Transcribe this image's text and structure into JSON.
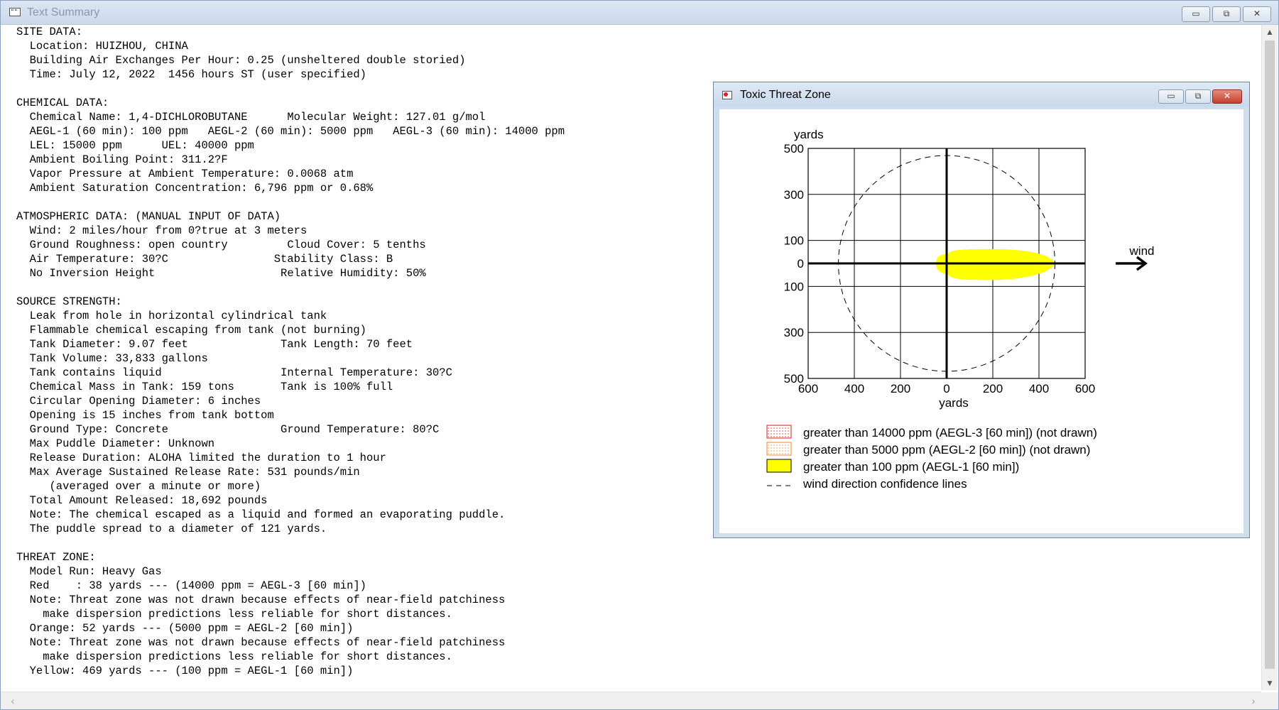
{
  "main_window": {
    "title": "Text Summary",
    "icon_text": "\"\"",
    "controls": {
      "minimize": "▭",
      "maximize": "⧉",
      "close": "✕"
    }
  },
  "summary_text": [
    "SITE DATA:",
    "  Location: HUIZHOU, CHINA",
    "  Building Air Exchanges Per Hour: 0.25 (unsheltered double storied)",
    "  Time: July 12, 2022  1456 hours ST (user specified)",
    "",
    "CHEMICAL DATA:",
    "  Chemical Name: 1,4-DICHLOROBUTANE      Molecular Weight: 127.01 g/mol",
    "  AEGL-1 (60 min): 100 ppm   AEGL-2 (60 min): 5000 ppm   AEGL-3 (60 min): 14000 ppm",
    "  LEL: 15000 ppm      UEL: 40000 ppm",
    "  Ambient Boiling Point: 311.2?F",
    "  Vapor Pressure at Ambient Temperature: 0.0068 atm",
    "  Ambient Saturation Concentration: 6,796 ppm or 0.68%",
    "",
    "ATMOSPHERIC DATA: (MANUAL INPUT OF DATA)",
    "  Wind: 2 miles/hour from 0?true at 3 meters",
    "  Ground Roughness: open country         Cloud Cover: 5 tenths",
    "  Air Temperature: 30?C                Stability Class: B",
    "  No Inversion Height                   Relative Humidity: 50%",
    "",
    "SOURCE STRENGTH:",
    "  Leak from hole in horizontal cylindrical tank",
    "  Flammable chemical escaping from tank (not burning)",
    "  Tank Diameter: 9.07 feet              Tank Length: 70 feet",
    "  Tank Volume: 33,833 gallons",
    "  Tank contains liquid                  Internal Temperature: 30?C",
    "  Chemical Mass in Tank: 159 tons       Tank is 100% full",
    "  Circular Opening Diameter: 6 inches",
    "  Opening is 15 inches from tank bottom",
    "  Ground Type: Concrete                 Ground Temperature: 80?C",
    "  Max Puddle Diameter: Unknown",
    "  Release Duration: ALOHA limited the duration to 1 hour",
    "  Max Average Sustained Release Rate: 531 pounds/min",
    "     (averaged over a minute or more)",
    "  Total Amount Released: 18,692 pounds",
    "  Note: The chemical escaped as a liquid and formed an evaporating puddle.",
    "  The puddle spread to a diameter of 121 yards.",
    "",
    "THREAT ZONE:",
    "  Model Run: Heavy Gas",
    "  Red    : 38 yards --- (14000 ppm = AEGL-3 [60 min])",
    "  Note: Threat zone was not drawn because effects of near-field patchiness",
    "    make dispersion predictions less reliable for short distances.",
    "  Orange: 52 yards --- (5000 ppm = AEGL-2 [60 min])",
    "  Note: Threat zone was not drawn because effects of near-field patchiness",
    "    make dispersion predictions less reliable for short distances.",
    "  Yellow: 469 yards --- (100 ppm = AEGL-1 [60 min])"
  ],
  "threat_window": {
    "title": "Toxic Threat Zone",
    "controls": {
      "minimize": "▭",
      "maximize": "⧉",
      "close": "✕"
    }
  },
  "plot": {
    "y_unit_label": "yards",
    "x_axis_label": "yards",
    "y_tick_labels": [
      "500",
      "300",
      "100",
      "0",
      "100",
      "300",
      "500"
    ],
    "x_tick_labels": [
      "600",
      "400",
      "200",
      "0",
      "200",
      "400",
      "600"
    ],
    "wind_label": "wind",
    "legend": [
      {
        "label": "greater than 14000 ppm (AEGL-3 [60 min]) (not drawn)",
        "swatch": "red-dotted"
      },
      {
        "label": "greater than 5000 ppm (AEGL-2 [60 min]) (not drawn)",
        "swatch": "orange-dotted"
      },
      {
        "label": "greater than 100 ppm (AEGL-1 [60 min])",
        "swatch": "yellow"
      },
      {
        "label": "wind direction confidence lines",
        "swatch": "dashed"
      }
    ],
    "colors": {
      "yellow_zone": "#ffff00",
      "red_zone": "#e0463b",
      "orange_zone": "#f0a050"
    }
  },
  "chart_data": {
    "type": "scatter",
    "x_range": [
      -600,
      600
    ],
    "y_range": [
      -500,
      500
    ],
    "y_ticks": [
      500,
      300,
      100,
      0,
      -100,
      -300,
      -500
    ],
    "x_ticks": [
      -600,
      -400,
      -200,
      0,
      200,
      400,
      600
    ],
    "grid": true,
    "yellow_zone_downwind_extent_yards": 469,
    "wind_direction": "toward +x"
  }
}
